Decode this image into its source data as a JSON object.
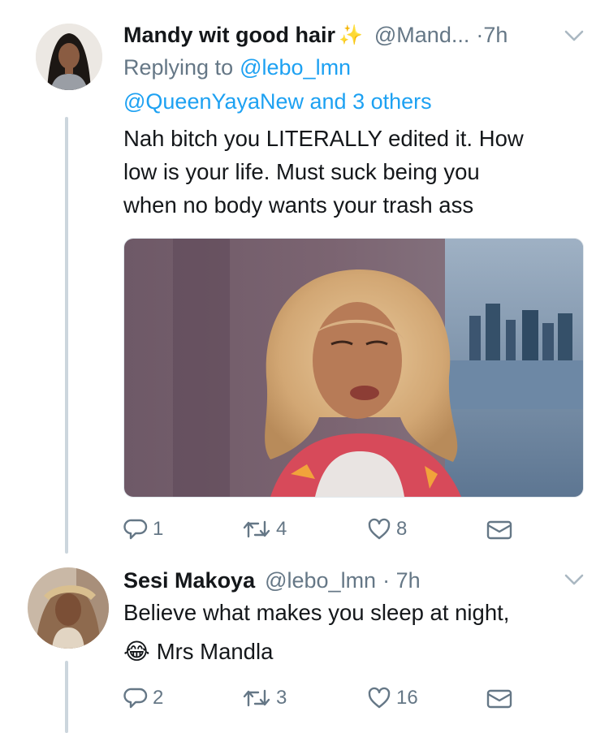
{
  "tweet1": {
    "author_name": "Mandy wit good hair",
    "author_emoji": "✨",
    "handle": "@Mand...",
    "time": "·7h",
    "replying_label": "Replying to",
    "reply_to_1": "@lebo_lmn",
    "reply_to_2": "@QueenYayaNew and 3 others",
    "text_line1": "Nah bitch you LITERALLY edited it. How",
    "text_line2": "low is your life. Must suck being you",
    "text_line3": "when no body wants your trash ass",
    "replies": "1",
    "retweets": "4",
    "likes": "8"
  },
  "tweet2": {
    "author_name": "Sesi Makoya",
    "handle": "@lebo_lmn",
    "time": "· 7h",
    "text_line1": "Believe what makes you sleep at night,",
    "emoji": "😂",
    "text_line2": "Mrs Mandla",
    "replies": "2",
    "retweets": "3",
    "likes": "16"
  },
  "icons": [
    "chevron-down-icon",
    "reply-icon",
    "retweet-icon",
    "heart-icon",
    "message-icon",
    "sparkles-emoji",
    "laughing-emoji"
  ],
  "colors": {
    "link": "#1da1f2",
    "muted": "#657786",
    "line": "#ccd6dd"
  }
}
